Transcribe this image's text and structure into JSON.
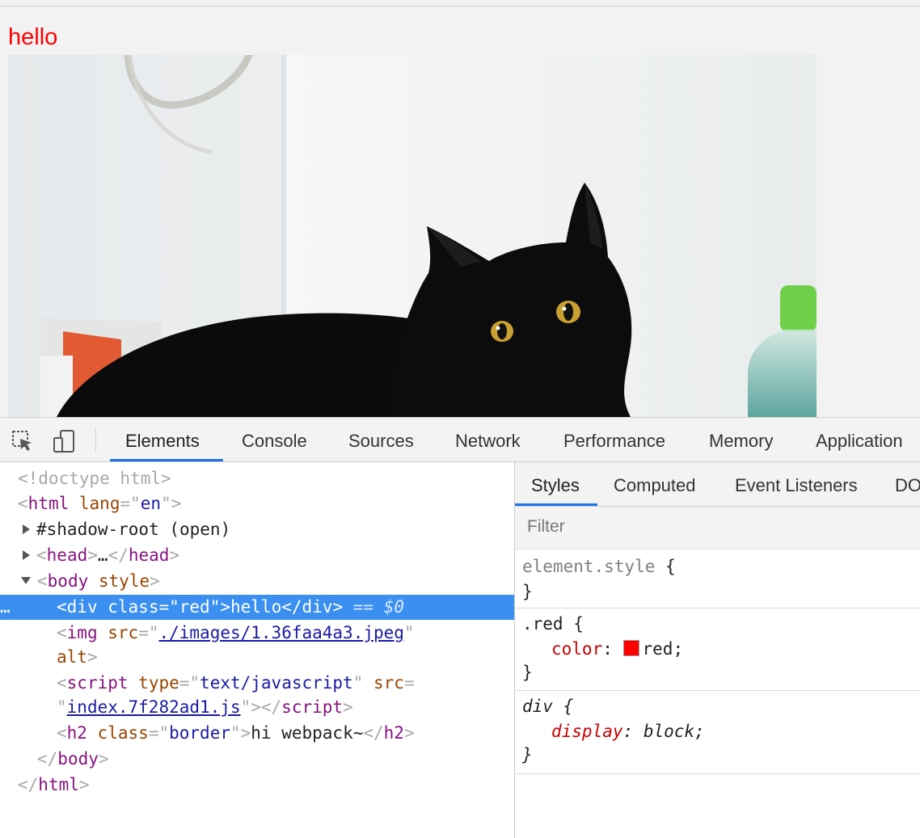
{
  "page": {
    "hello_text": "hello"
  },
  "devtools": {
    "tabs": [
      "Elements",
      "Console",
      "Sources",
      "Network",
      "Performance",
      "Memory",
      "Application"
    ],
    "dom": {
      "doctype": "<!doctype html>",
      "html_open": "html",
      "lang_attr": "lang",
      "lang_val": "en",
      "shadow_root": "#shadow-root (open)",
      "head": "head",
      "head_ellipsis": "…",
      "body": "body",
      "body_attr": "style",
      "div_tag": "div",
      "div_class_attr": "class",
      "div_class_val": "red",
      "div_text": "hello",
      "div_marker": "== $0",
      "ellipsis_marker": "…",
      "img_tag": "img",
      "img_src_attr": "src",
      "img_src_val": "./images/1.36faa4a3.jpeg",
      "img_alt_attr": "alt",
      "script_tag": "script",
      "script_type_attr": "type",
      "script_type_val": "text/javascript",
      "script_src_attr": "src",
      "script_src_val": "index.7f282ad1.js",
      "h2_tag": "h2",
      "h2_class_attr": "class",
      "h2_class_val": "border",
      "h2_text": "hi webpack~"
    },
    "styles": {
      "tabs": [
        "Styles",
        "Computed",
        "Event Listeners",
        "DO"
      ],
      "filter_placeholder": "Filter",
      "rules": {
        "element_style": "element.style",
        "red_selector": ".red",
        "red_prop": "color",
        "red_value": "red",
        "div_selector": "div",
        "div_prop": "display",
        "div_value": "block"
      },
      "swatch_color": "#ff0000"
    }
  }
}
